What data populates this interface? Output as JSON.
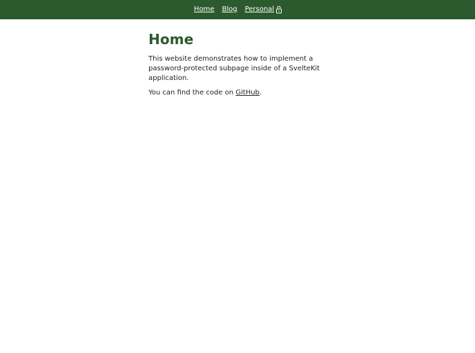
{
  "nav": {
    "items": [
      {
        "label": "Home"
      },
      {
        "label": "Blog"
      },
      {
        "label": "Personal",
        "icon": "lock-icon"
      }
    ]
  },
  "main": {
    "title": "Home",
    "paragraph1": "This website demonstrates how to implement a password-protected subpage inside of a SvelteKit application.",
    "paragraph2_prefix": "You can find the code on ",
    "paragraph2_link": "GitHub",
    "paragraph2_suffix": "."
  },
  "colors": {
    "header_bg": "#2b5a2e",
    "title": "#2b5a2e",
    "nav_text": "#ffffff"
  }
}
